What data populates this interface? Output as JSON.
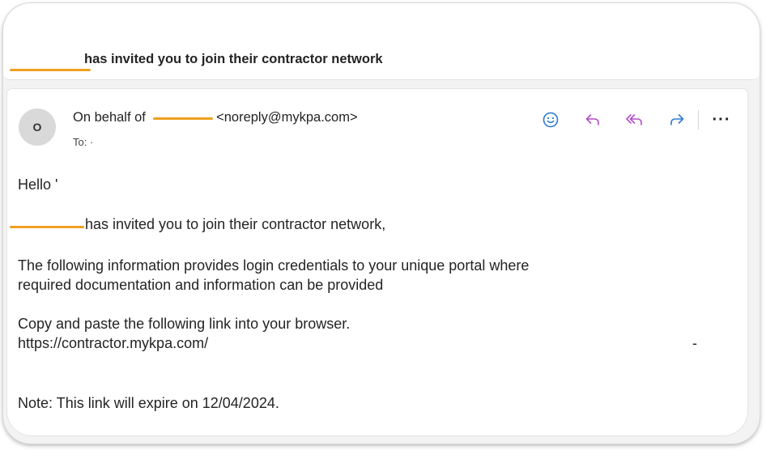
{
  "subject": "has invited you to join their contractor network",
  "sender": {
    "avatar_initial": "O",
    "prefix": "On behalf of",
    "email": "<noreply@mykpa.com>",
    "to_label": "To:",
    "to_value": "·"
  },
  "actions": [
    {
      "name": "emoji-reaction",
      "icon": "smiley-icon"
    },
    {
      "name": "reply",
      "icon": "reply-icon"
    },
    {
      "name": "reply-all",
      "icon": "reply-all-icon"
    },
    {
      "name": "forward",
      "icon": "forward-icon"
    }
  ],
  "more_label": "···",
  "body": {
    "greeting": "Hello '",
    "invite_line": "has invited you to join their contractor network,",
    "info_line1": "The following information provides login credentials to your unique portal where",
    "info_line2": "required documentation and information can be provided",
    "copy_line": "Copy and paste the following link into your browser.",
    "link": "https://contractor.mykpa.com/",
    "trailing_dash": "-",
    "note": "Note: This link will expire on 12/04/2024."
  },
  "colors": {
    "redaction": "#f0a020",
    "icon_blue": "#2e7bd6",
    "icon_purple": "#b14fc5"
  }
}
